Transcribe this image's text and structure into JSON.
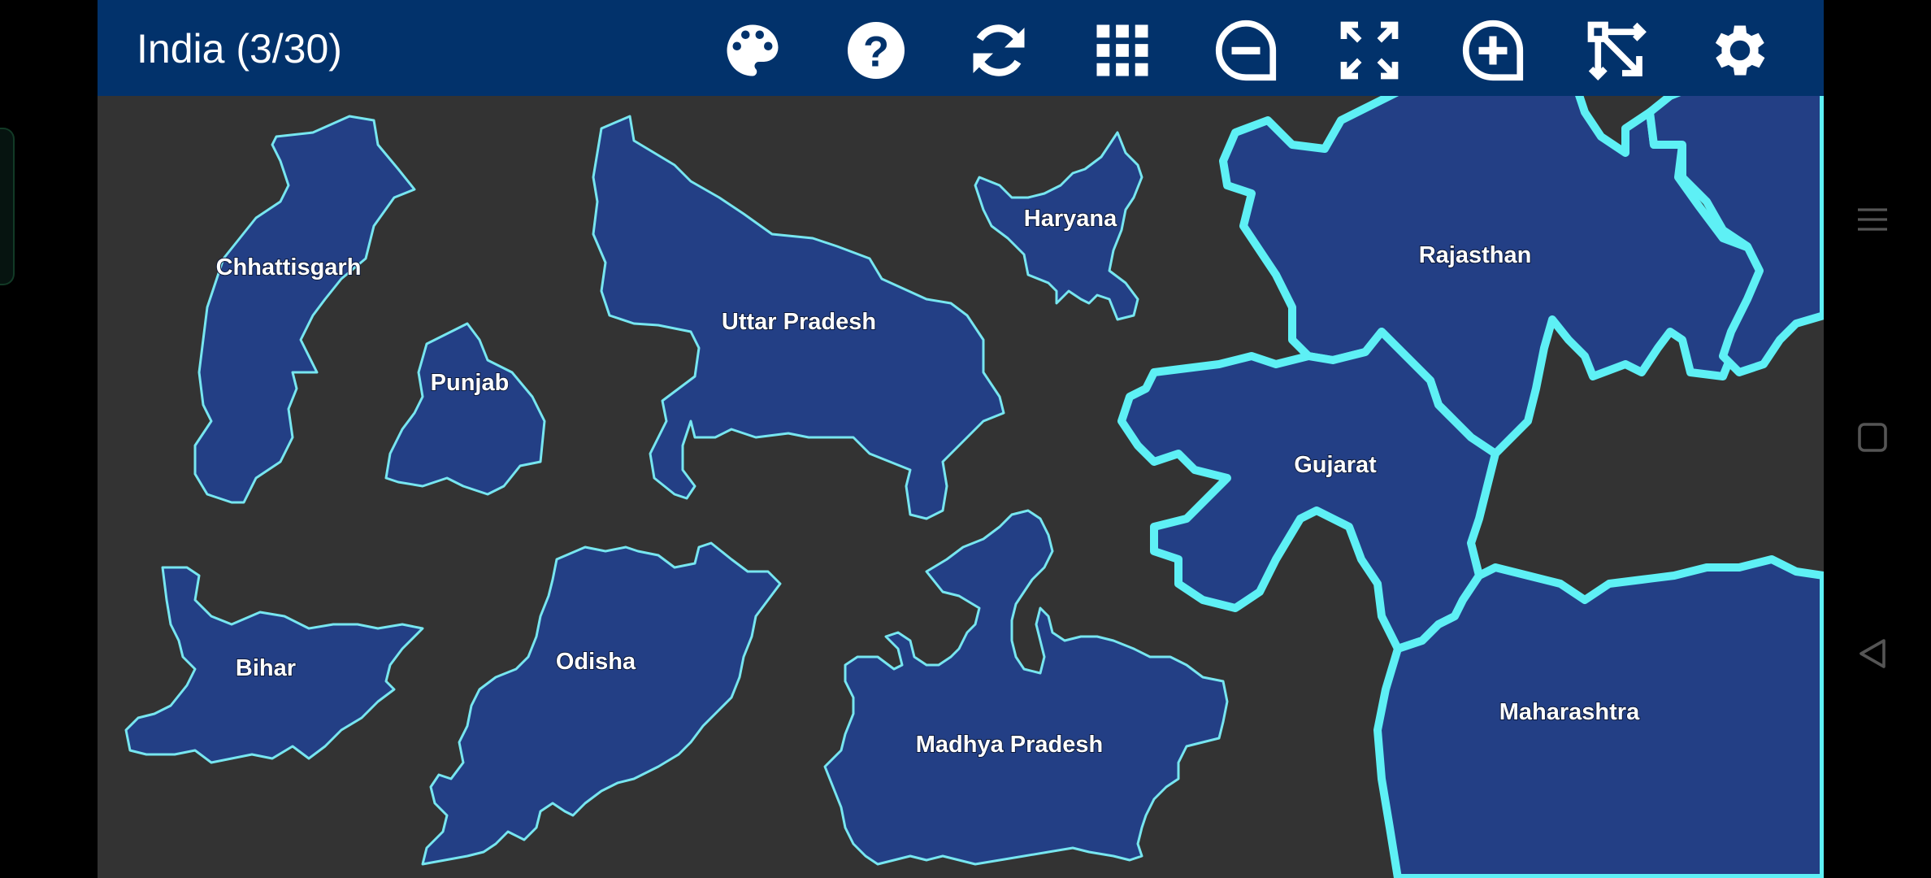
{
  "app": {
    "title": "India (3/30)",
    "colors": {
      "header": "#02326b",
      "canvas": "#333333",
      "piece_fill": "#233f85",
      "piece_outline": "#77e6f0",
      "placed_outline": "#5ef0f5"
    }
  },
  "toolbar": {
    "buttons": [
      {
        "id": "palette",
        "icon": "palette-icon"
      },
      {
        "id": "help",
        "icon": "help-circle-icon"
      },
      {
        "id": "refresh",
        "icon": "refresh-icon"
      },
      {
        "id": "grid",
        "icon": "grid-icon"
      },
      {
        "id": "zoom-out",
        "icon": "zoom-out-icon"
      },
      {
        "id": "fit-screen",
        "icon": "expand-arrows-icon"
      },
      {
        "id": "zoom-in",
        "icon": "zoom-in-icon"
      },
      {
        "id": "scatter",
        "icon": "scatter-arrows-icon"
      },
      {
        "id": "settings",
        "icon": "gear-icon"
      }
    ]
  },
  "pieces": {
    "chhattisgarh": "Chhattisgarh",
    "punjab": "Punjab",
    "uttar_pradesh": "Uttar Pradesh",
    "haryana": "Haryana",
    "bihar": "Bihar",
    "odisha": "Odisha",
    "madhya_pradesh": "Madhya Pradesh"
  },
  "placed": {
    "rajasthan": "Rajasthan",
    "gujarat": "Gujarat",
    "maharashtra": "Maharashtra"
  },
  "navbar": {
    "icons": [
      "menu-icon",
      "square-icon",
      "back-triangle-icon"
    ]
  }
}
